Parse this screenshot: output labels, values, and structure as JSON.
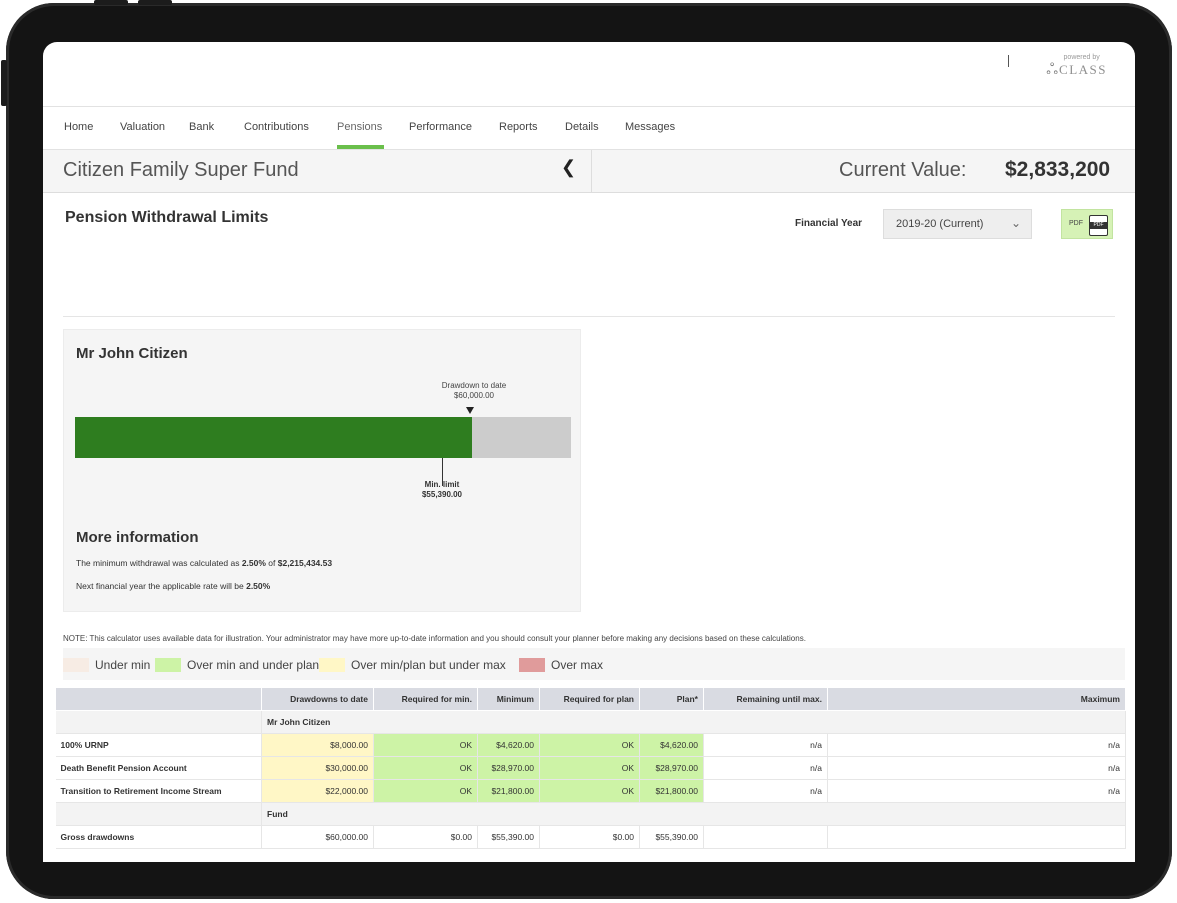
{
  "brand": {
    "powered_by": "powered by",
    "logo_text": "CLASS"
  },
  "nav": {
    "items": [
      "Home",
      "Valuation",
      "Bank",
      "Contributions",
      "Pensions",
      "Performance",
      "Reports",
      "Details",
      "Messages"
    ],
    "active": "Pensions"
  },
  "fund": {
    "name": "Citizen Family Super Fund",
    "current_value_label": "Current Value:",
    "current_value": "$2,833,200"
  },
  "page": {
    "title": "Pension Withdrawal Limits",
    "financial_year_label": "Financial Year",
    "financial_year_value": "2019-20 (Current)",
    "pdf_label": "PDF",
    "pdf_icon_text": "PDF"
  },
  "card": {
    "person": "Mr John Citizen",
    "drawdown_label": "Drawdown to date",
    "drawdown_value": "$60,000.00",
    "drawdown_fraction": 0.8,
    "min_limit_label": "Min. limit",
    "min_limit_value": "$55,390.00",
    "min_limit_fraction": 0.74,
    "more_info_title": "More information",
    "info1_prefix": "The minimum withdrawal was calculated as ",
    "info1_rate": "2.50%",
    "info1_mid": " of ",
    "info1_amount": "$2,215,434.53",
    "info2_prefix": "Next financial year the applicable rate will be ",
    "info2_rate": "2.50%"
  },
  "note": "NOTE: This calculator uses available data for illustration. Your administrator may have more up-to-date information and you should consult your planner before making any decisions based on these calculations.",
  "legend": [
    {
      "label": "Under min",
      "color": "#f7ece4"
    },
    {
      "label": "Over min and under plan",
      "color": "#cdf3a6"
    },
    {
      "label": "Over min/plan but under max",
      "color": "#fff7c6"
    },
    {
      "label": "Over max",
      "color": "#e09b9b"
    }
  ],
  "table": {
    "headers": [
      "",
      "Drawdowns to date",
      "Required for min.",
      "Minimum",
      "Required for plan",
      "Plan*",
      "Remaining until max.",
      "Maximum"
    ],
    "group1": "Mr John Citizen",
    "rows": [
      {
        "label": "100% URNP",
        "drawdowns": "$8,000.00",
        "req_min": "OK",
        "minimum": "$4,620.00",
        "req_plan": "OK",
        "plan": "$4,620.00",
        "remaining": "n/a",
        "maximum": "n/a"
      },
      {
        "label": "Death Benefit Pension Account",
        "drawdowns": "$30,000.00",
        "req_min": "OK",
        "minimum": "$28,970.00",
        "req_plan": "OK",
        "plan": "$28,970.00",
        "remaining": "n/a",
        "maximum": "n/a"
      },
      {
        "label": "Transition to Retirement Income Stream",
        "drawdowns": "$22,000.00",
        "req_min": "OK",
        "minimum": "$21,800.00",
        "req_plan": "OK",
        "plan": "$21,800.00",
        "remaining": "n/a",
        "maximum": "n/a"
      }
    ],
    "group2": "Fund",
    "gross": {
      "label": "Gross drawdowns",
      "drawdowns": "$60,000.00",
      "req_min": "$0.00",
      "minimum": "$55,390.00",
      "req_plan": "$0.00",
      "plan": "$55,390.00",
      "remaining": "",
      "maximum": ""
    }
  }
}
